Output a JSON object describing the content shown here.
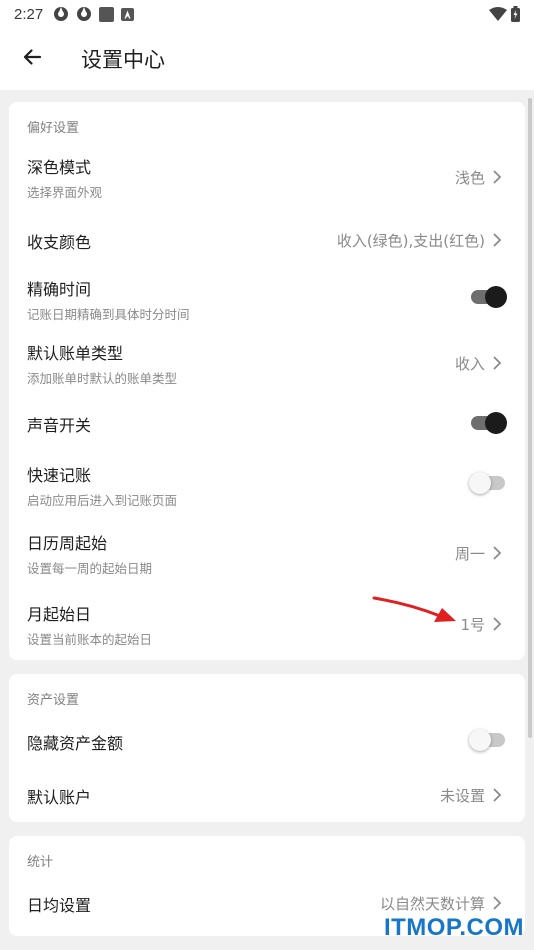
{
  "status_bar": {
    "time": "2:27",
    "icons": [
      "settings-app-icon",
      "settings-app-icon",
      "square-notification-icon",
      "a-notification-icon",
      "wifi-icon",
      "battery-icon"
    ]
  },
  "app_bar": {
    "back_icon": "arrow-left-icon",
    "title": "设置中心"
  },
  "sections": {
    "preferences": {
      "title": "偏好设置",
      "dark_mode": {
        "title": "深色模式",
        "subtitle": "选择界面外观",
        "value": "浅色"
      },
      "income_expense_color": {
        "title": "收支颜色",
        "value": "收入(绿色),支出(红色)"
      },
      "precise_time": {
        "title": "精确时间",
        "subtitle": "记账日期精确到具体时分时间",
        "enabled": true
      },
      "default_bill_type": {
        "title": "默认账单类型",
        "subtitle": "添加账单时默认的账单类型",
        "value": "收入"
      },
      "sound_switch": {
        "title": "声音开关",
        "enabled": true
      },
      "quick_entry": {
        "title": "快速记账",
        "subtitle": "启动应用后进入到记账页面",
        "enabled": false
      },
      "calendar_week_start": {
        "title": "日历周起始",
        "subtitle": "设置每一周的起始日期",
        "value": "周一"
      },
      "month_start_day": {
        "title": "月起始日",
        "subtitle": "设置当前账本的起始日",
        "value": "1号"
      }
    },
    "assets": {
      "title": "资产设置",
      "hide_asset_amount": {
        "title": "隐藏资产金额",
        "enabled": false
      },
      "default_account": {
        "title": "默认账户",
        "value": "未设置"
      }
    },
    "statistics": {
      "title": "统计",
      "daily_average": {
        "title": "日均设置",
        "value": "以自然天数计算"
      }
    }
  },
  "watermark": "ITMOP.COM",
  "colors": {
    "background": "#f0f0f0",
    "card": "#ffffff",
    "toggle_on_thumb": "#1b1b1b",
    "toggle_on_track": "#6e6e6e",
    "toggle_off_track": "#c8c8c8",
    "annotation_arrow": "#e02020",
    "watermark": "#1676c8"
  }
}
